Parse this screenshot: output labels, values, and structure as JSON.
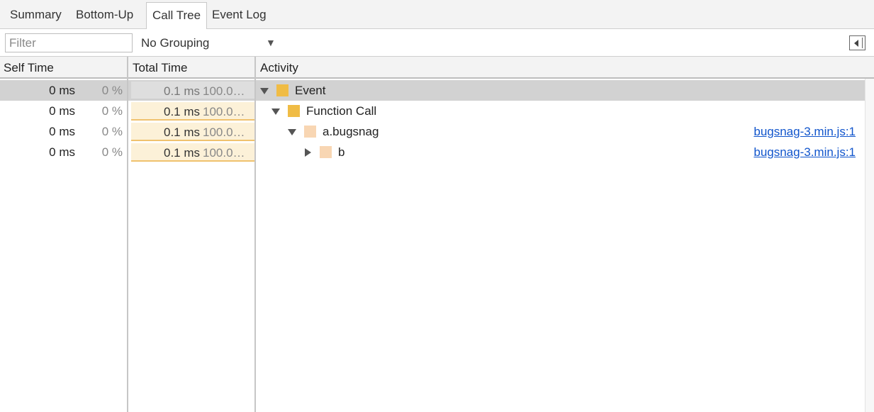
{
  "tabs": [
    {
      "label": "Summary",
      "active": false
    },
    {
      "label": "Bottom-Up",
      "active": false
    },
    {
      "label": "Call Tree",
      "active": true
    },
    {
      "label": "Event Log",
      "active": false
    }
  ],
  "toolbar": {
    "filter_placeholder": "Filter",
    "filter_value": "",
    "grouping_value": "No Grouping",
    "grouping_arrow": "▼",
    "dock_icon": "dock-side-icon"
  },
  "columns": {
    "self_time": "Self Time",
    "total_time": "Total Time",
    "activity": "Activity"
  },
  "rows": [
    {
      "self_ms": "0 ms",
      "self_pct": "0 %",
      "total_ms": "0.1 ms",
      "total_pct": "100.0…",
      "label": "Event",
      "expanded": true,
      "swatch": "#f0bc45",
      "source": "",
      "selected": true
    },
    {
      "self_ms": "0 ms",
      "self_pct": "0 %",
      "total_ms": "0.1 ms",
      "total_pct": "100.0…",
      "label": "Function Call",
      "expanded": true,
      "swatch": "#f0bc45",
      "source": "",
      "selected": false
    },
    {
      "self_ms": "0 ms",
      "self_pct": "0 %",
      "total_ms": "0.1 ms",
      "total_pct": "100.0…",
      "label": "a.bugsnag",
      "expanded": true,
      "swatch": "#f8d6b3",
      "source": "bugsnag-3.min.js:1",
      "selected": false
    },
    {
      "self_ms": "0 ms",
      "self_pct": "0 %",
      "total_ms": "0.1 ms",
      "total_pct": "100.0…",
      "label": "b",
      "expanded": false,
      "swatch": "#f8d6b3",
      "source": "bugsnag-3.min.js:1",
      "selected": false
    }
  ],
  "colors": {
    "selected_row": "#d2d2d2",
    "total_bar": "#fcf1d8",
    "total_bar_border": "#f0c26e",
    "link": "#1155cc"
  }
}
